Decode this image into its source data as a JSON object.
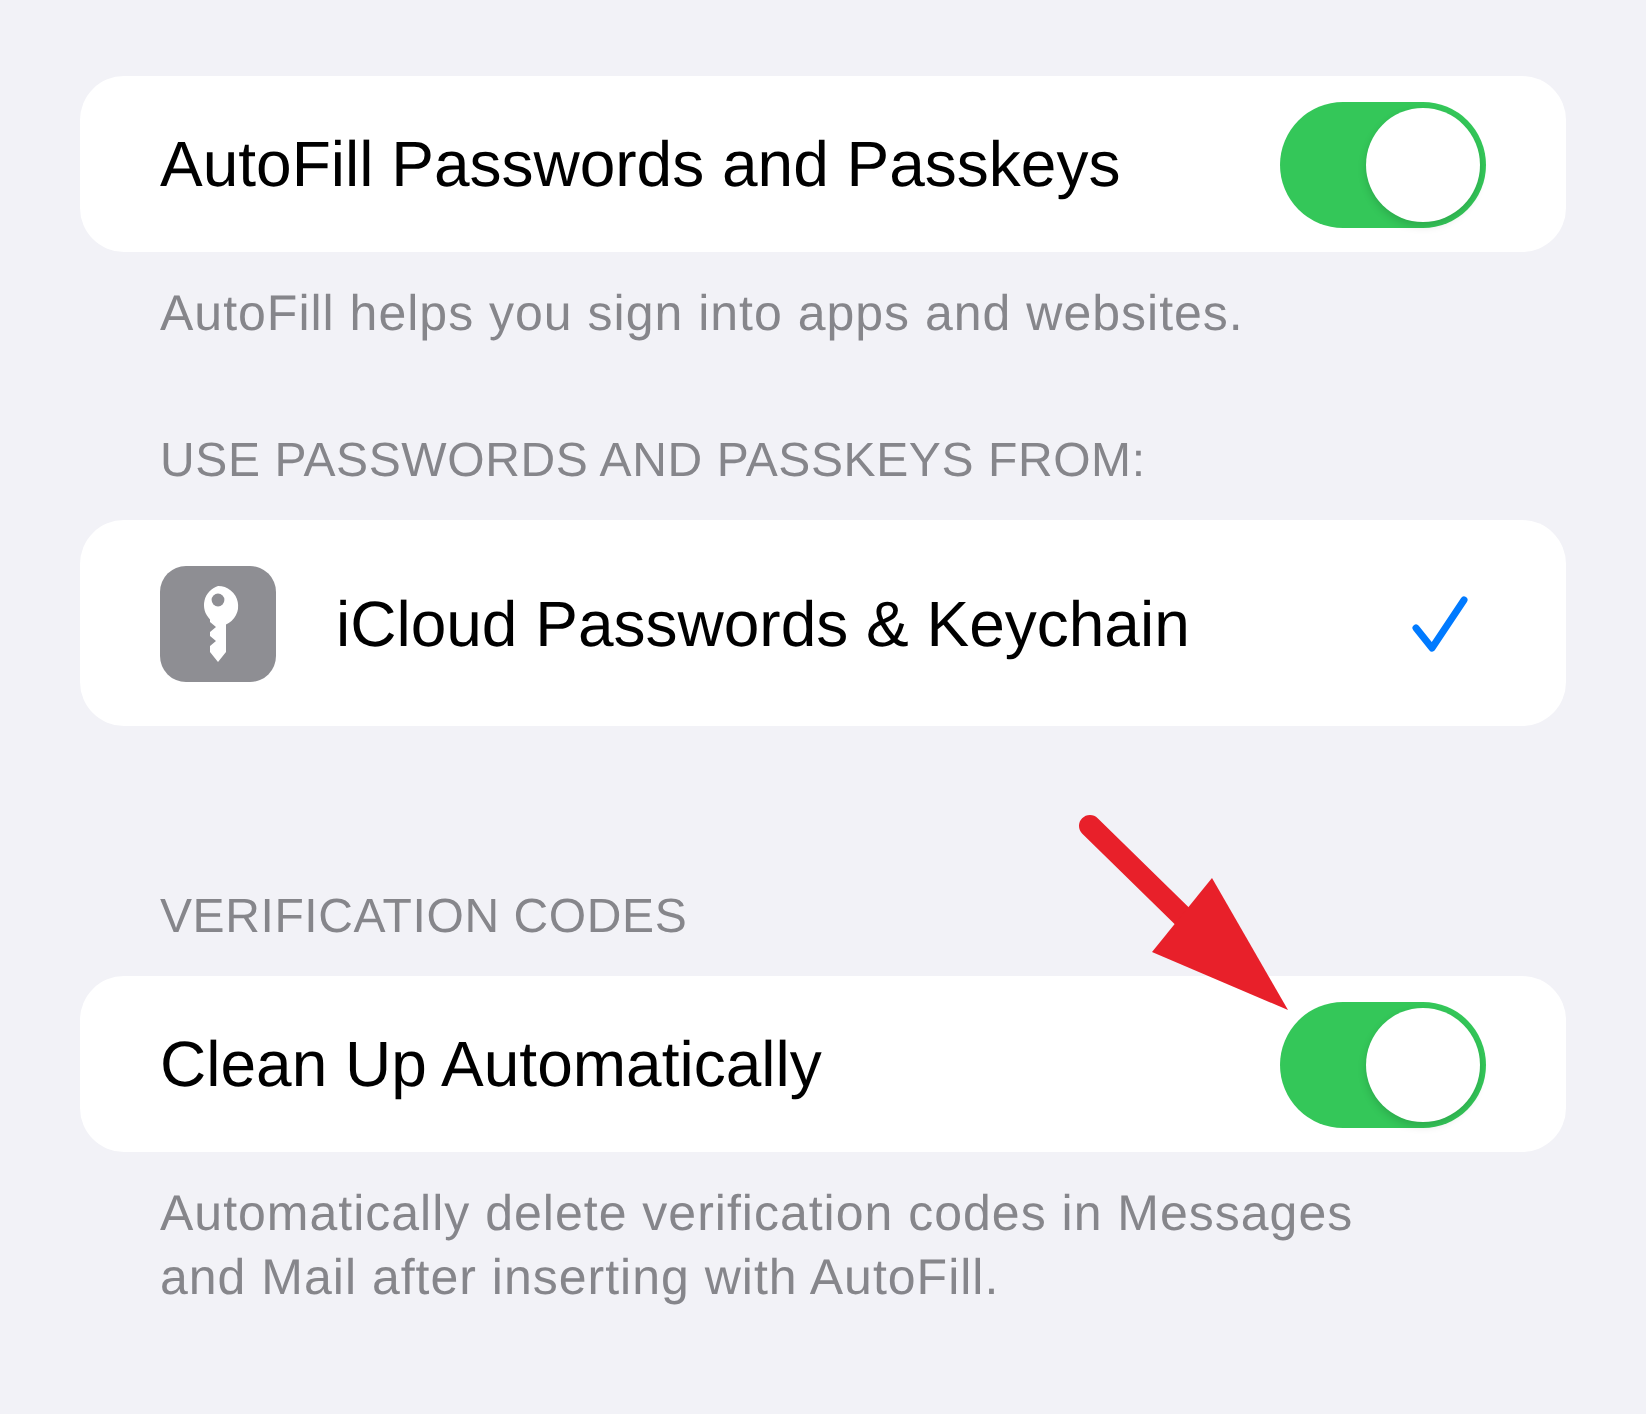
{
  "sections": [
    {
      "rows": [
        {
          "kind": "toggle",
          "label": "AutoFill Passwords and Passkeys",
          "on": true,
          "annotated": false
        }
      ],
      "footer": "AutoFill helps you sign into apps and websites."
    },
    {
      "header": "USE PASSWORDS AND PASSKEYS FROM:",
      "rows": [
        {
          "kind": "option",
          "label": "iCloud Passwords & Keychain",
          "selected": true
        }
      ]
    },
    {
      "header": "VERIFICATION CODES",
      "rows": [
        {
          "kind": "toggle",
          "label": "Clean Up Automatically",
          "on": true,
          "annotated": true
        }
      ],
      "footer": "Automatically delete verification codes in Messages and Mail after inserting with AutoFill."
    }
  ]
}
